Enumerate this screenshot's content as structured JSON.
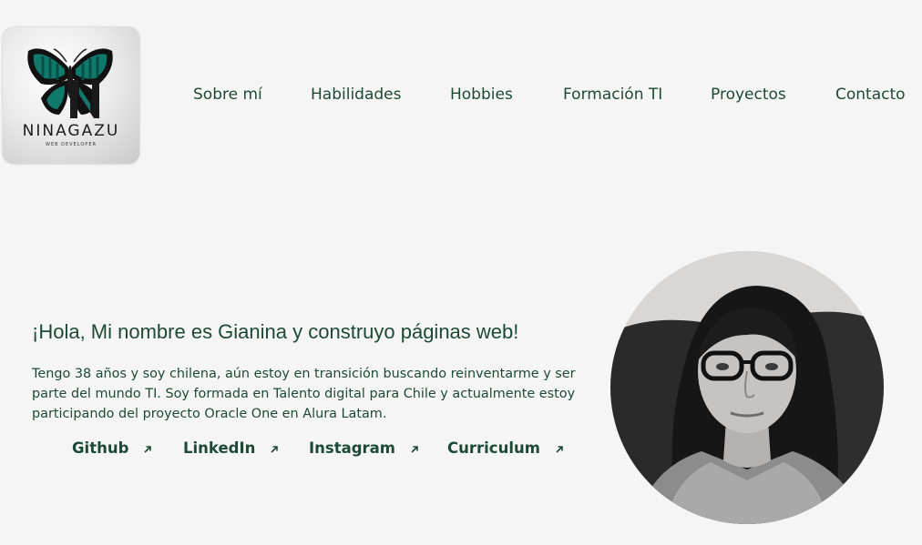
{
  "logo": {
    "name": "NINAGAZU",
    "subtitle": "WEB DEVELOPER",
    "icon": "butterfly-icon"
  },
  "nav": {
    "items": [
      {
        "label": "Sobre mí"
      },
      {
        "label": "Habilidades"
      },
      {
        "label": "Hobbies"
      },
      {
        "label": "Formación TI"
      },
      {
        "label": "Proyectos"
      },
      {
        "label": "Contacto"
      }
    ]
  },
  "hero": {
    "title": "¡Hola, Mi nombre es Gianina y construyo páginas web!",
    "description": "Tengo 38 años y soy chilena, aún estoy en transición buscando reinventarme y ser parte del mundo TI. Soy formada en Talento digital para Chile y actualmente estoy participando del proyecto Oracle One en Alura Latam.",
    "links": [
      {
        "label": "Github",
        "icon": "external-arrow-icon"
      },
      {
        "label": "LinkedIn",
        "icon": "external-arrow-icon"
      },
      {
        "label": "Instagram",
        "icon": "external-arrow-icon"
      },
      {
        "label": "Curriculum",
        "icon": "external-arrow-icon"
      }
    ]
  },
  "profile": {
    "image": "profile-photo"
  },
  "colors": {
    "background": "#f5f5f5",
    "text": "#1d4a36",
    "logo_accent": "#0f7a6b"
  }
}
